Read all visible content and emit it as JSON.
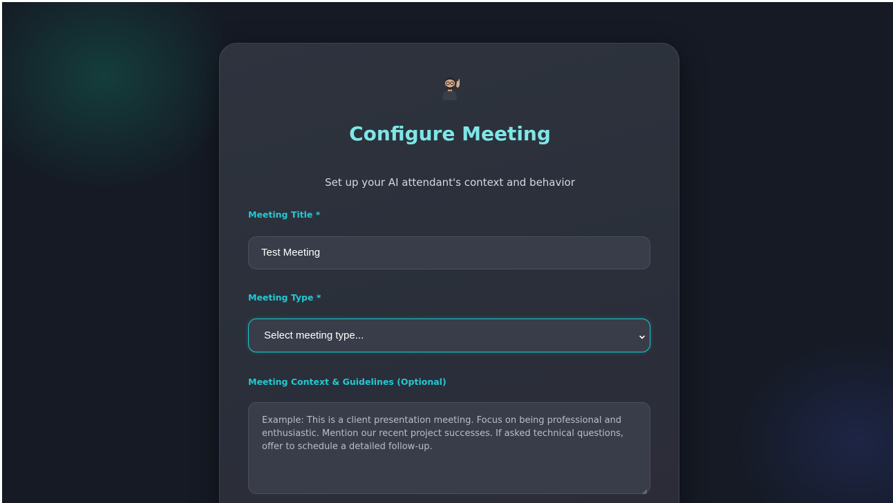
{
  "form": {
    "avatar_icon": "person-waving-icon",
    "title": "Configure Meeting",
    "subtitle": "Set up your AI attendant's context and behavior",
    "meeting_title": {
      "label": "Meeting Title *",
      "value": "Test Meeting"
    },
    "meeting_type": {
      "label": "Meeting Type *",
      "selected": "Select meeting type..."
    },
    "context": {
      "label": "Meeting Context & Guidelines (Optional)",
      "placeholder_lines": [
        "Example: This is a client presentation meeting. Focus on being professional and",
        "enthusiastic. Mention our recent project successes. If asked technical questions,",
        "offer to schedule a detailed follow-up."
      ]
    }
  },
  "colors": {
    "accent": "#22c9d2",
    "title": "#7fe6e6",
    "background": "#151a24",
    "card": "#2e333e"
  }
}
